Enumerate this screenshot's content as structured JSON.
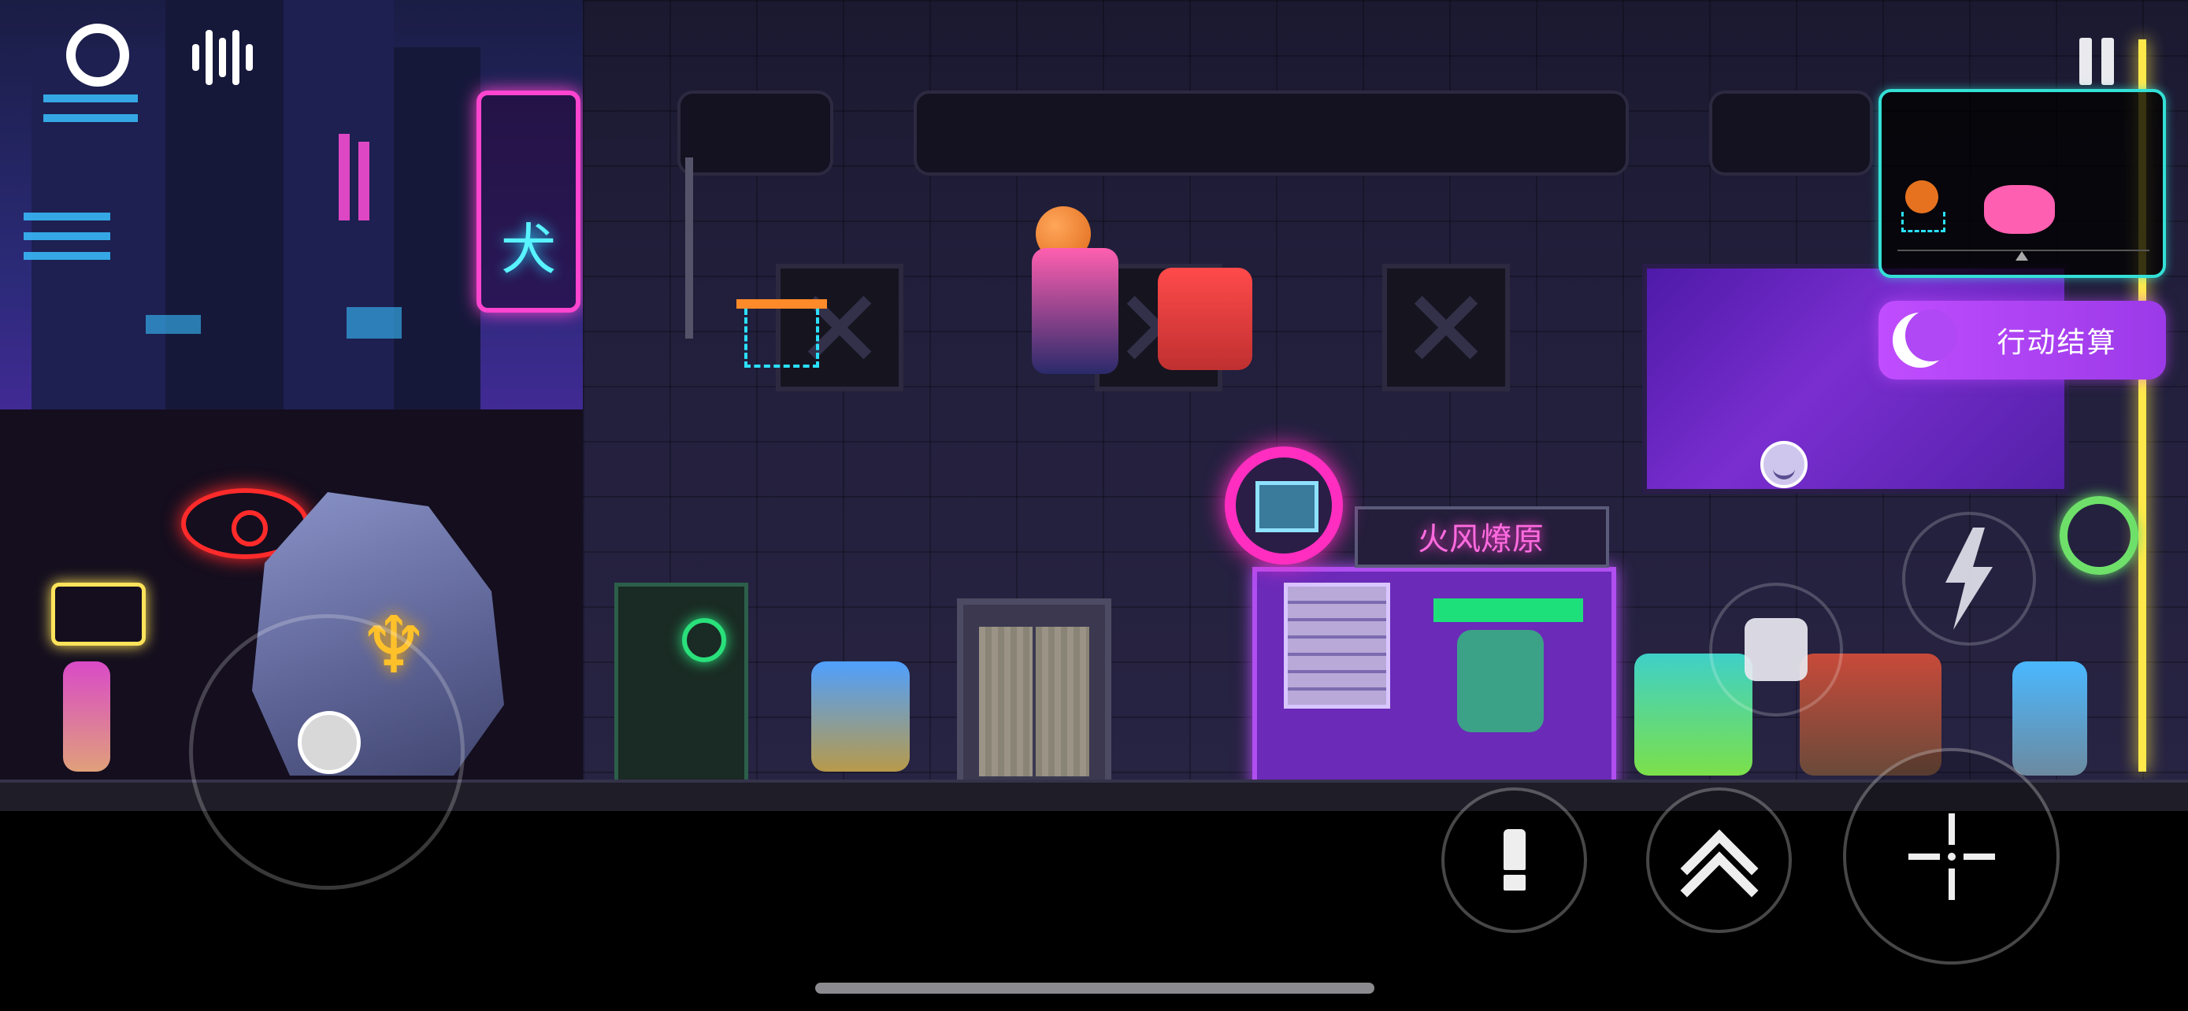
{
  "hud": {
    "end_action_label": "行动结算",
    "colors": {
      "accent_purple": "#b048f5",
      "minimap_border": "#33e0d6",
      "neon_pink": "#ff45d0",
      "neon_yellow": "#ffe94a"
    },
    "icons": {
      "top_left_1": "ring-icon",
      "top_left_2": "voice-wave-icon",
      "top_right": "pause-icon",
      "end_action": "crescent-moon-icon",
      "action_1": "dash-icon",
      "action_2": "jump-chevron-icon",
      "action_3": "crosshair-icon"
    }
  },
  "world": {
    "shop_sign": "火风燎原",
    "neon_sign_glyph": "犬",
    "rock_glyph": "♆"
  }
}
